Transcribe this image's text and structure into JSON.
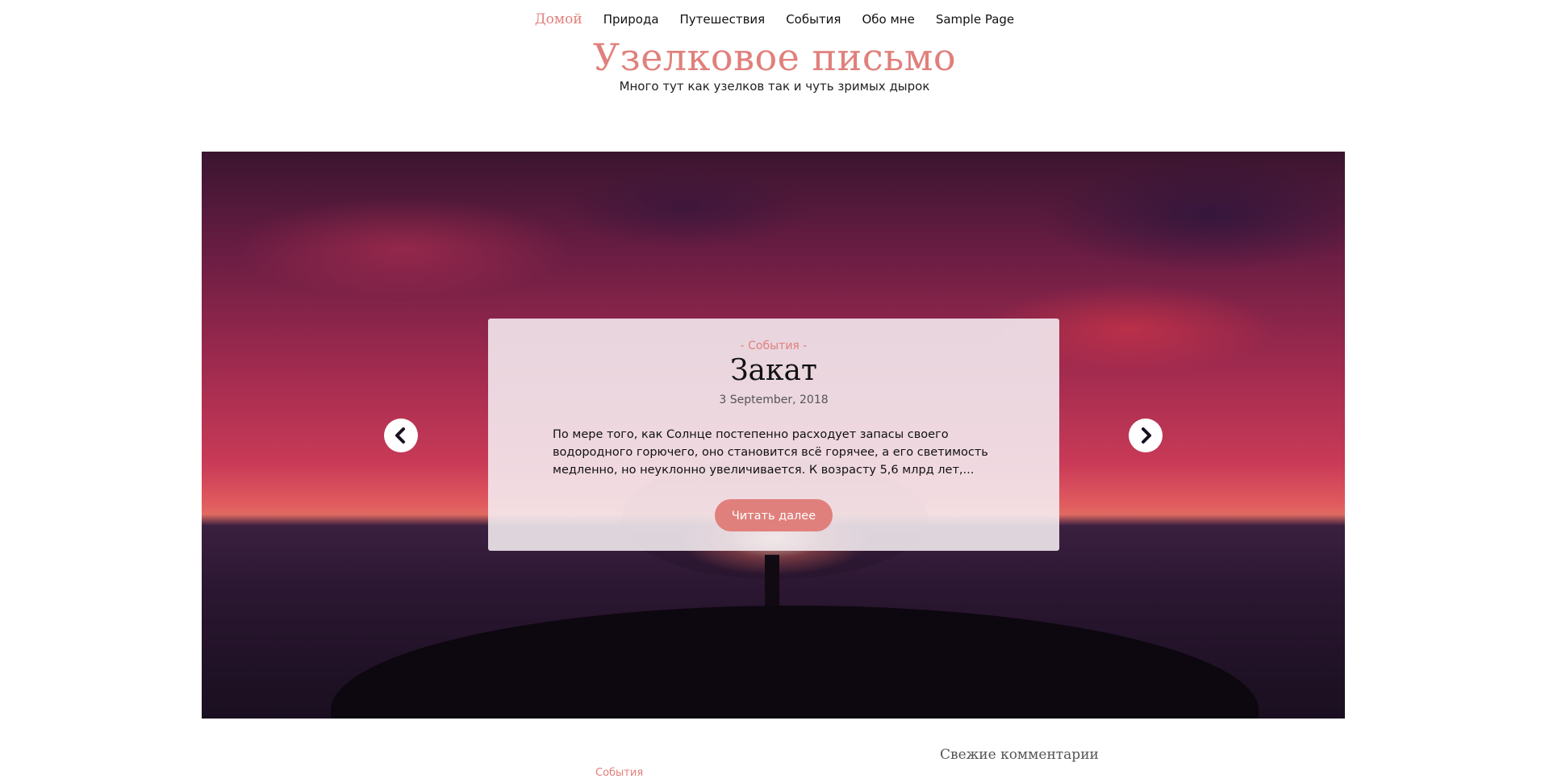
{
  "nav": {
    "items": [
      {
        "label": "Домой",
        "active": true
      },
      {
        "label": "Природа"
      },
      {
        "label": "Путешествия"
      },
      {
        "label": "События"
      },
      {
        "label": "Обо мне"
      },
      {
        "label": "Sample Page"
      }
    ]
  },
  "site": {
    "title": "Узелковое письмо",
    "tagline": "Много тут как узелков так и чуть зримых дырок"
  },
  "slide": {
    "category": "- События -",
    "title": "Закат",
    "date": "3 September, 2018",
    "excerpt": "По мере того, как Солнце постепенно расходует запасы своего водородного горючего, оно становится всё горячее, а его светимость медленно, но неуклонно увеличивается. К возрасту 5,6 млрд лет,...",
    "read_more": "Читать далее",
    "prev_icon": "chevron-left-icon",
    "next_icon": "chevron-right-icon"
  },
  "sidebar": {
    "heading": "Свежие комментарии"
  },
  "post": {
    "category": "События"
  },
  "colors": {
    "accent": "#e0807c",
    "card_bg": "#f5eef2",
    "text": "#111111"
  }
}
